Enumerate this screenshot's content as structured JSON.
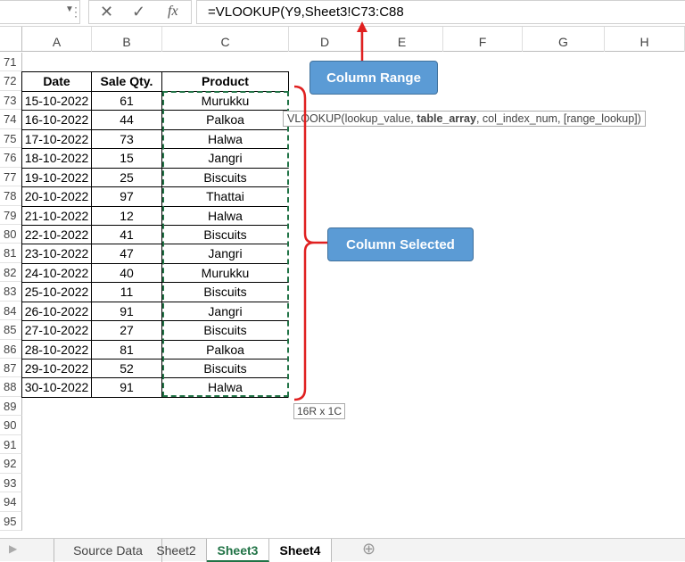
{
  "formula_bar": {
    "formula": "=VLOOKUP(Y9,Sheet3!C73:C88",
    "cancel_icon": "x-icon",
    "enter_icon": "check-icon",
    "fx_label": "fx"
  },
  "columns": [
    "A",
    "B",
    "C",
    "D",
    "E",
    "F",
    "G",
    "H"
  ],
  "rows": [
    "71",
    "72",
    "73",
    "74",
    "75",
    "76",
    "77",
    "78",
    "79",
    "80",
    "81",
    "82",
    "83",
    "84",
    "85",
    "86",
    "87",
    "88",
    "89",
    "90",
    "91",
    "92",
    "93",
    "94",
    "95"
  ],
  "table": {
    "headers": [
      "Date",
      "Sale Qty.",
      "Product"
    ],
    "data": [
      [
        "15-10-2022",
        "61",
        "Murukku"
      ],
      [
        "16-10-2022",
        "44",
        "Palkoa"
      ],
      [
        "17-10-2022",
        "73",
        "Halwa"
      ],
      [
        "18-10-2022",
        "15",
        "Jangri"
      ],
      [
        "19-10-2022",
        "25",
        "Biscuits"
      ],
      [
        "20-10-2022",
        "97",
        "Thattai"
      ],
      [
        "21-10-2022",
        "12",
        "Halwa"
      ],
      [
        "22-10-2022",
        "41",
        "Biscuits"
      ],
      [
        "23-10-2022",
        "47",
        "Jangri"
      ],
      [
        "24-10-2022",
        "40",
        "Murukku"
      ],
      [
        "25-10-2022",
        "11",
        "Biscuits"
      ],
      [
        "26-10-2022",
        "91",
        "Jangri"
      ],
      [
        "27-10-2022",
        "27",
        "Biscuits"
      ],
      [
        "28-10-2022",
        "81",
        "Palkoa"
      ],
      [
        "29-10-2022",
        "52",
        "Biscuits"
      ],
      [
        "30-10-2022",
        "91",
        "Halwa"
      ]
    ]
  },
  "tooltip": {
    "pre": "VLOOKUP(lookup_value, ",
    "bold": "table_array",
    "post": ", col_index_num, [range_lookup])"
  },
  "size_hint": "16R x 1C",
  "callouts": {
    "range": "Column Range",
    "selected": "Column Selected"
  },
  "sheet_tabs": [
    "Source Data",
    "Sheet2",
    "Sheet3",
    "Sheet4"
  ],
  "active_tab": "Sheet3",
  "colors": {
    "accent_green": "#217346",
    "callout_blue": "#5b9bd5",
    "annotation_red": "#e02020"
  }
}
